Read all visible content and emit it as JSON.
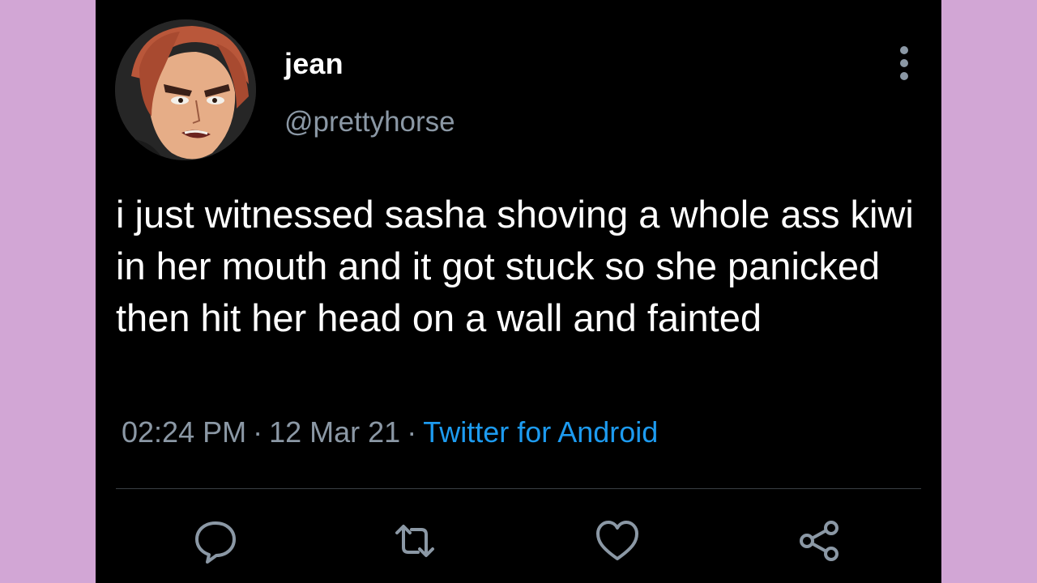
{
  "user": {
    "display_name": "jean",
    "handle": "@prettyhorse",
    "avatar_icon": "anime-character-avatar"
  },
  "tweet": {
    "text": "i just witnessed sasha shoving a whole ass kiwi in her mouth and it got stuck so she panicked then hit her head on a wall and fainted",
    "time": "02:24 PM",
    "separator": "·",
    "date": "12 Mar 21",
    "source": "Twitter for Android"
  },
  "actions": {
    "reply_icon": "reply-icon",
    "retweet_icon": "retweet-icon",
    "like_icon": "heart-icon",
    "share_icon": "share-icon",
    "more_icon": "more-vertical-icon"
  },
  "colors": {
    "background": "#d2a6d5",
    "card": "#000000",
    "text": "#ffffff",
    "muted": "#8b98a5",
    "link": "#1d9bf0"
  }
}
